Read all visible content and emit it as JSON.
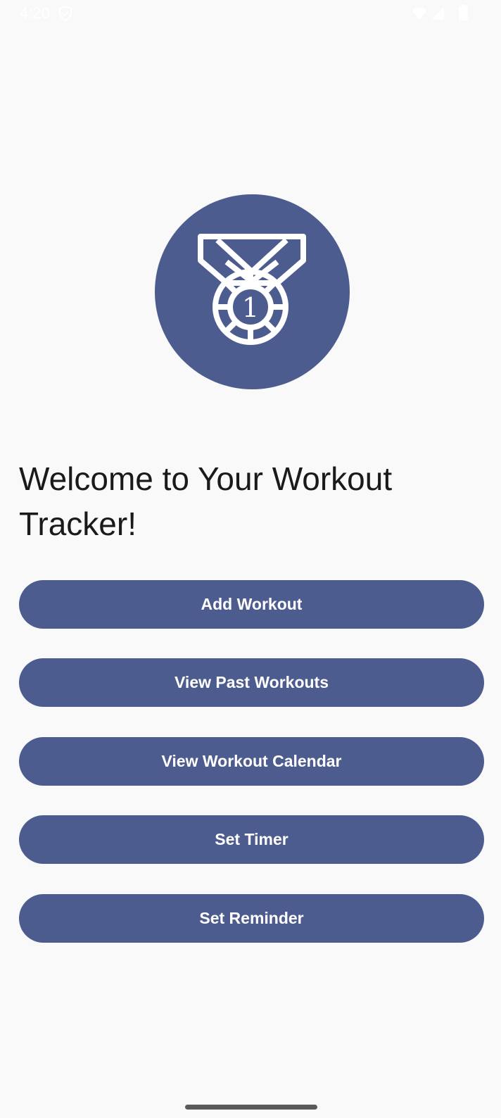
{
  "status_bar": {
    "time": "4:20",
    "icons": [
      "shield-icon",
      "wifi-icon",
      "signal-icon",
      "battery-icon"
    ]
  },
  "logo": {
    "icon": "medal-icon",
    "number": "1"
  },
  "welcome_text": "Welcome to Your Workout Tracker!",
  "buttons": {
    "add_workout": "Add Workout",
    "view_past_workouts": "View Past Workouts",
    "view_workout_calendar": "View Workout Calendar",
    "set_timer": "Set Timer",
    "set_reminder": "Set Reminder"
  },
  "colors": {
    "accent": "#4d5c8f",
    "background": "#f9f9f9",
    "button_text": "#ffffff"
  }
}
